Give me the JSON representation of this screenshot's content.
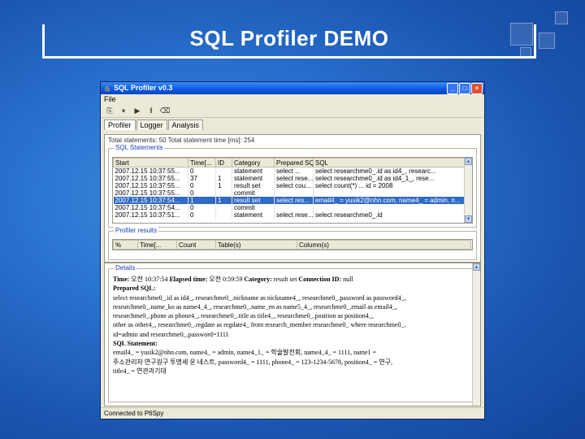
{
  "slide": {
    "title": "SQL Profiler DEMO"
  },
  "window": {
    "title": "SQL Profiler v0.3",
    "menu": [
      "File"
    ],
    "tabs": [
      "Profiler",
      "Logger",
      "Analysis"
    ],
    "toolbar_icons": [
      "profile-icon",
      "pause-icon",
      "play-icon",
      "stop-icon",
      "clear-icon"
    ]
  },
  "info_line": "Total statements: 50    Total statement time [ms]: 254",
  "sql_statements": {
    "label": "SQL Statements",
    "columns": [
      "Start",
      "Time[...",
      "ID",
      "Category",
      "Prepared SQL",
      "SQL"
    ],
    "rows": [
      [
        "2007.12.15 10:37:55...",
        "0",
        "",
        "statement",
        "select ... ",
        "select researchme0_.id as id4_, researc..."
      ],
      [
        "2007.12.15 10:37:55...",
        "37",
        "1",
        "statement",
        "select rese...",
        "select researchme0_.id as id4_1_, rese..."
      ],
      [
        "2007.12.15 10:37:55...",
        "0",
        "1",
        "result set",
        "select cou...",
        "select count(*) ... id = 2008"
      ],
      [
        "2007.12.15 10:37:55...",
        "0",
        "",
        "commit",
        "",
        ""
      ],
      [
        "2007.12.15 10:37:54...",
        "1",
        "1",
        "result set",
        "select res...",
        "email4_ = yusik2@nhn.com, name4_ = admin, n..."
      ],
      [
        "2007.12.15 10:37:54...",
        "0",
        "",
        "commit",
        "",
        ""
      ],
      [
        "2007.12.15 10:37:51...",
        "0",
        "",
        "statement",
        "select rese...",
        "select researchme0_.id"
      ]
    ],
    "selected_index": 4
  },
  "profiler_results": {
    "label": "Profiler results",
    "columns": [
      "%",
      "Time[...",
      "Count",
      "Table(s)",
      "Column(s)"
    ]
  },
  "details": {
    "label": "Details",
    "lines": [
      {
        "k": "Time:",
        "v": "오전 10:37:54  ",
        "k2": "Elapsed time:",
        "v2": "오전 0:59:59  ",
        "k3": "Category:",
        "v3": "result set  ",
        "k4": "Connection ID:",
        "v4": "null"
      },
      {
        "k": "Prepared SQL:",
        "v": ""
      },
      {
        "v": "select researchme0_.id as id4_, researchme0_.nickname as nickname4_, researchme0_.password as password4_,"
      },
      {
        "v": "researchme0_.name_ko as name4_4_, researchme0_.name_en as name5_4_, researchme0_.email as email4_,"
      },
      {
        "v": "researchme0_.phone as phone4_, researchme0_.title as title4_, researchme0_.position as position4_,"
      },
      {
        "v": "other as other4_, researchme0_.regdate as regdate4_ from research_member researchme0_ where researchme0_."
      },
      {
        "v": "id=admin and researchme0_.password=1111"
      },
      {
        "k": "SQL Statement:",
        "v": ""
      },
      {
        "v": "email4_ = yusik2@nhn.com, name4_ = admin, name4_1_ = 학술발전회, name4_4_ = 1111, name1 = "
      },
      {
        "v": "주소관리자 연구원구 투명세 운 네스트, password4_ = 1111, phone4_ = 123-1234-5678, position4_ = 연구,"
      },
      {
        "v": "title4_ = 연관과기대"
      }
    ]
  },
  "status": "Connected to P6Spy"
}
